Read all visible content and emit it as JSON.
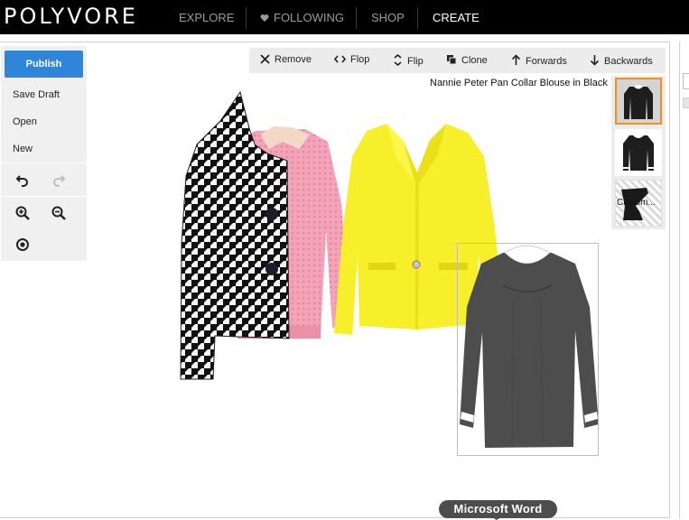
{
  "nav": {
    "logo": "POLYVORE",
    "items": [
      {
        "label": "EXPLORE"
      },
      {
        "label": "FOLLOWING",
        "icon": "heart-icon"
      },
      {
        "label": "SHOP"
      },
      {
        "label": "CREATE",
        "active": true
      }
    ]
  },
  "left_toolbar": {
    "publish_label": "Publish",
    "items": [
      "Save Draft",
      "Open",
      "New"
    ],
    "icons": [
      "undo-icon",
      "redo-icon",
      "zoom-in-icon",
      "zoom-out-icon",
      "center-icon"
    ]
  },
  "top_toolbar": {
    "items": [
      {
        "label": "Remove",
        "icon": "close-icon"
      },
      {
        "label": "Flop",
        "icon": "flop-icon"
      },
      {
        "label": "Flip",
        "icon": "flip-icon"
      },
      {
        "label": "Clone",
        "icon": "clone-icon"
      },
      {
        "label": "Forwards",
        "icon": "arrow-up-icon"
      },
      {
        "label": "Backwards",
        "icon": "arrow-down-icon"
      }
    ]
  },
  "selected_item": {
    "title": "Nannie Peter Pan Collar Blouse in Black"
  },
  "variants": {
    "custom_label": "Custom..."
  },
  "canvas_items": [
    {
      "name": "houndstooth-coat",
      "colors": [
        "#1a1a1a",
        "#ffffff"
      ]
    },
    {
      "name": "pink-sweater",
      "color": "#f4a3bb"
    },
    {
      "name": "yellow-blazer",
      "color": "#f7ef2a"
    },
    {
      "name": "black-blouse",
      "color": "#4a4a4a"
    }
  ],
  "dock_tooltip": "Microsoft Word",
  "colors": {
    "accent": "#2f86d8",
    "selection": "#f3901d",
    "topbar": "#000000"
  }
}
